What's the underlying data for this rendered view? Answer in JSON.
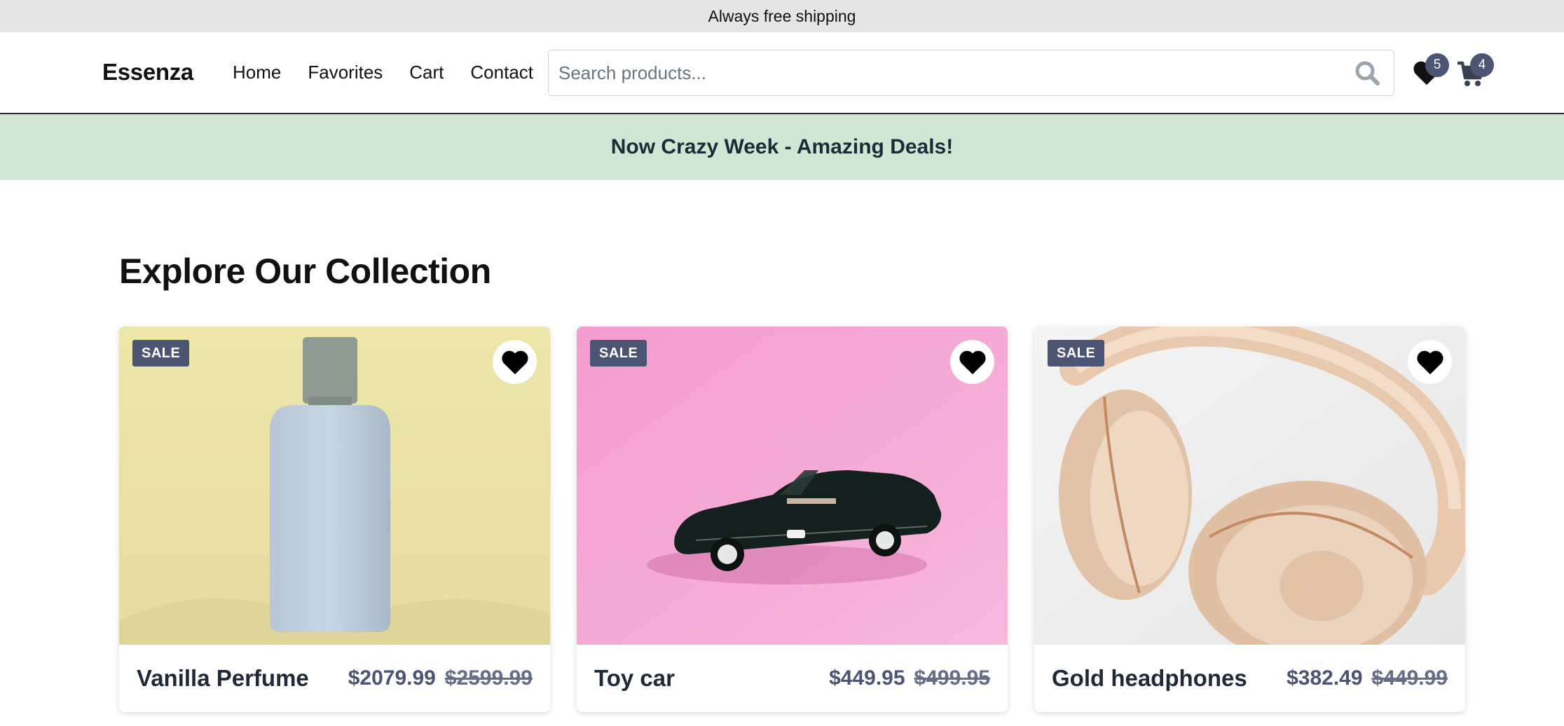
{
  "topbar": {
    "text": "Always free shipping"
  },
  "header": {
    "logo": "Essenza",
    "nav": [
      "Home",
      "Favorites",
      "Cart",
      "Contact"
    ],
    "search": {
      "placeholder": "Search products...",
      "value": ""
    },
    "favorites_count": "5",
    "cart_count": "4"
  },
  "promo": {
    "text": "Now Crazy Week - Amazing Deals!"
  },
  "main": {
    "title": "Explore Our Collection",
    "products": [
      {
        "name": "Vanilla Perfume",
        "price": "$2079.99",
        "old_price": "$2599.99",
        "badge": "SALE"
      },
      {
        "name": "Toy car",
        "price": "$449.95",
        "old_price": "$499.95",
        "badge": "SALE"
      },
      {
        "name": "Gold headphones",
        "price": "$382.49",
        "old_price": "$449.99",
        "badge": "SALE"
      }
    ]
  },
  "colors": {
    "accent": "#4b5473",
    "promo_bg": "#d3e6d3",
    "topbar_bg": "#e5e5e5"
  }
}
